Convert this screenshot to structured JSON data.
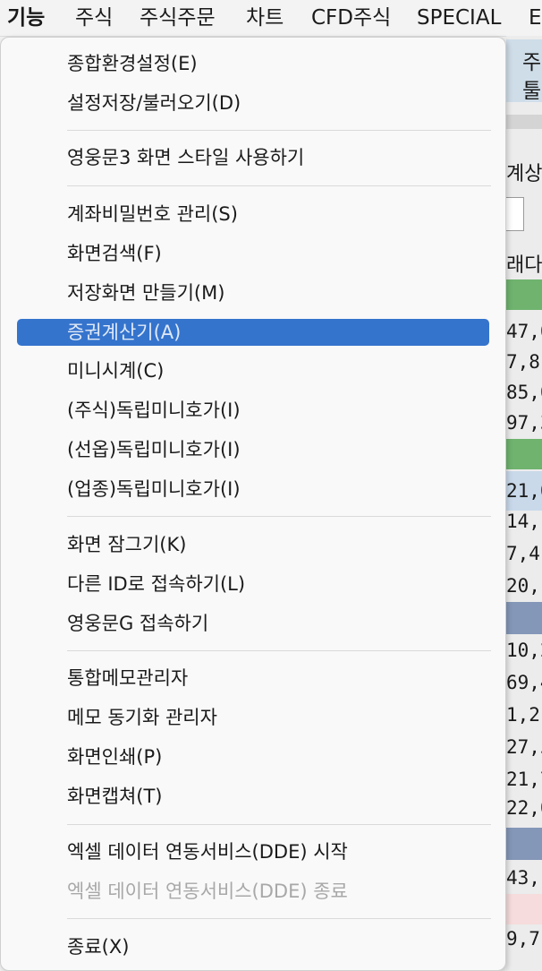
{
  "menubar": {
    "items": [
      "기능",
      "주식",
      "주식주문",
      "차트",
      "CFD주식",
      "SPECIAL",
      "E"
    ]
  },
  "background": {
    "tab_line1": "주",
    "tab_line2": "툴",
    "label_a": "계상",
    "label_b": "래다",
    "rows": [
      "47,0",
      "7,8",
      "85,0",
      "97,3",
      "21,0",
      "14,",
      "7,4",
      "20,",
      "10,2",
      "69,4",
      "1,2",
      "27,5",
      "21,7",
      "22,0",
      "43,",
      "9,7"
    ]
  },
  "dropdown": {
    "items": [
      "종합환경설정(E)",
      "설정저장/불러오기(D)",
      "영웅문3 화면 스타일 사용하기",
      "계좌비밀번호 관리(S)",
      "화면검색(F)",
      "저장화면 만들기(M)",
      "증권계산기(A)",
      "미니시계(C)",
      "(주식)독립미니호가(I)",
      "(선옵)독립미니호가(I)",
      "(업종)독립미니호가(I)",
      "화면 잠그기(K)",
      "다른 ID로 접속하기(L)",
      "영웅문G 접속하기",
      "통합메모관리자",
      "메모 동기화 관리자",
      "화면인쇄(P)",
      "화면캡쳐(T)",
      "엑셀 데이터 연동서비스(DDE) 시작",
      "엑셀 데이터 연동서비스(DDE) 종료",
      "종료(X)"
    ],
    "highlighted_index": 6,
    "disabled_index": 19
  },
  "colors": {
    "highlight": "#3574cd",
    "green_band": "#6fb36f",
    "blue_band": "#8497b8",
    "light_blue_row": "#c9d9ea",
    "pink_band": "#f6dcdc"
  }
}
